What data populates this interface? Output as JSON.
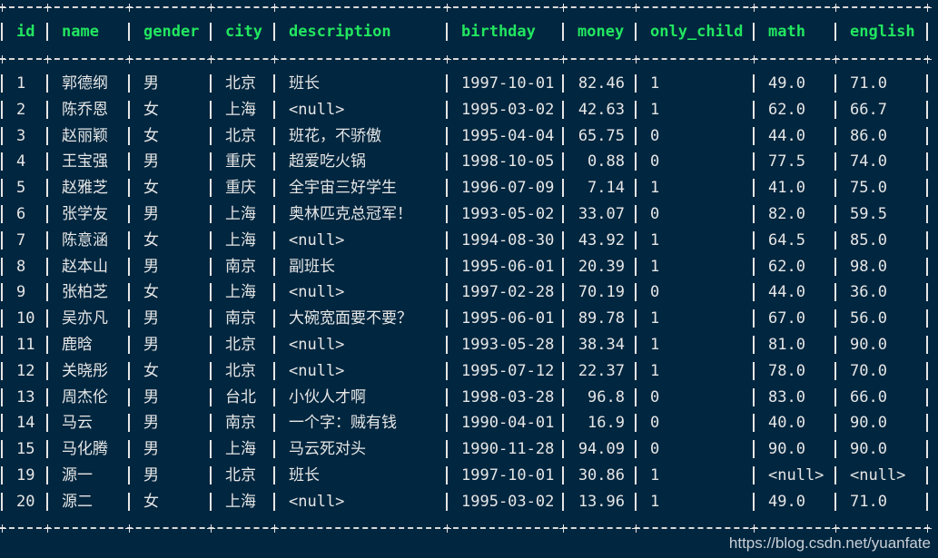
{
  "colors": {
    "background": "#01263f",
    "header": "#22e660",
    "text": "#e6e6e6"
  },
  "columns": [
    "id",
    "name",
    "gender",
    "city",
    "description",
    "birthday",
    "money",
    "only_child",
    "math",
    "english"
  ],
  "rows": [
    [
      "1",
      "郭德纲",
      "男",
      "北京",
      "班长",
      "1997-10-01",
      "82.46",
      "1",
      "49.0",
      "71.0"
    ],
    [
      "2",
      "陈乔恩",
      "女",
      "上海",
      "<null>",
      "1995-03-02",
      "42.63",
      "1",
      "62.0",
      "66.7"
    ],
    [
      "3",
      "赵丽颖",
      "女",
      "北京",
      "班花，不骄傲",
      "1995-04-04",
      "65.75",
      "0",
      "44.0",
      "86.0"
    ],
    [
      "4",
      "王宝强",
      "男",
      "重庆",
      "超爱吃火锅",
      "1998-10-05",
      "0.88",
      "0",
      "77.5",
      "74.0"
    ],
    [
      "5",
      "赵雅芝",
      "女",
      "重庆",
      "全宇宙三好学生",
      "1996-07-09",
      "7.14",
      "1",
      "41.0",
      "75.0"
    ],
    [
      "6",
      "张学友",
      "男",
      "上海",
      "奥林匹克总冠军！",
      "1993-05-02",
      "33.07",
      "0",
      "82.0",
      "59.5"
    ],
    [
      "7",
      "陈意涵",
      "女",
      "上海",
      "<null>",
      "1994-08-30",
      "43.92",
      "1",
      "64.5",
      "85.0"
    ],
    [
      "8",
      "赵本山",
      "男",
      "南京",
      "副班长",
      "1995-06-01",
      "20.39",
      "1",
      "62.0",
      "98.0"
    ],
    [
      "9",
      "张柏芝",
      "女",
      "上海",
      "<null>",
      "1997-02-28",
      "70.19",
      "0",
      "44.0",
      "36.0"
    ],
    [
      "10",
      "吴亦凡",
      "男",
      "南京",
      "大碗宽面要不要？",
      "1995-06-01",
      "89.78",
      "1",
      "67.0",
      "56.0"
    ],
    [
      "11",
      "鹿晗",
      "男",
      "北京",
      "<null>",
      "1993-05-28",
      "38.34",
      "1",
      "81.0",
      "90.0"
    ],
    [
      "12",
      "关晓彤",
      "女",
      "北京",
      "<null>",
      "1995-07-12",
      "22.37",
      "1",
      "78.0",
      "70.0"
    ],
    [
      "13",
      "周杰伦",
      "男",
      "台北",
      "小伙人才啊",
      "1998-03-28",
      "96.8",
      "0",
      "83.0",
      "66.0"
    ],
    [
      "14",
      "马云",
      "男",
      "南京",
      "一个字：贼有钱",
      "1990-04-01",
      "16.9",
      "0",
      "40.0",
      "90.0"
    ],
    [
      "15",
      "马化腾",
      "男",
      "上海",
      "马云死对头",
      "1990-11-28",
      "94.09",
      "0",
      "90.0",
      "90.0"
    ],
    [
      "19",
      "源一",
      "男",
      "北京",
      "班长",
      "1997-10-01",
      "30.86",
      "1",
      "<null>",
      "<null>"
    ],
    [
      "20",
      "源二",
      "女",
      "上海",
      "<null>",
      "1995-03-02",
      "13.96",
      "1",
      "49.0",
      "71.0"
    ]
  ],
  "watermark": "https://blog.csdn.net/yuanfate"
}
